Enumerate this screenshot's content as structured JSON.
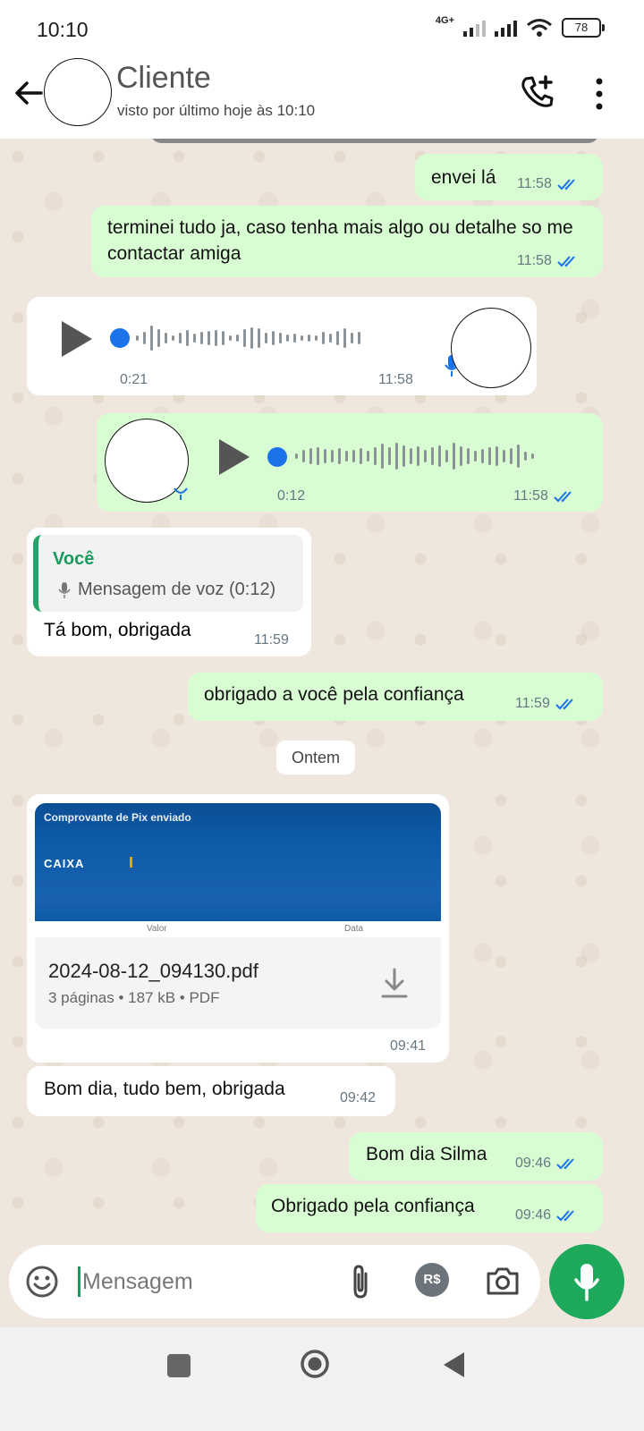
{
  "status_bar": {
    "time": "10:10",
    "network": "4G+",
    "battery": "78"
  },
  "header": {
    "name": "Cliente",
    "status": "visto por último hoje às 10:10"
  },
  "messages": {
    "m1": {
      "text": "envei lá",
      "time": "11:58"
    },
    "m2": {
      "text": "terminei tudo ja, caso tenha mais algo ou detalhe so me contactar amiga",
      "time": "11:58"
    },
    "voice_in": {
      "duration": "0:21",
      "time": "11:58"
    },
    "voice_out": {
      "duration": "0:12",
      "time": "11:58"
    },
    "reply": {
      "quoted_name": "Você",
      "quoted_text": "Mensagem de voz (0:12)",
      "text": "Tá bom, obrigada",
      "time": "11:59"
    },
    "m3": {
      "text": "obrigado a você pela confiança",
      "time": "11:59"
    },
    "date_chip": "Ontem",
    "pdf": {
      "preview_title": "Comprovante de Pix enviado",
      "preview_logo": "CAIXA",
      "preview_col_a": "Valor",
      "preview_col_b": "Data",
      "file_name": "2024-08-12_094130.pdf",
      "file_meta": "3 páginas • 187 kB • PDF",
      "time": "09:41"
    },
    "m4": {
      "text": "Bom dia, tudo bem, obrigada",
      "time": "09:42"
    },
    "m5": {
      "text": "Bom dia Silma",
      "time": "09:46"
    },
    "m6": {
      "text": "Obrigado pela confiança",
      "time": "09:46"
    }
  },
  "input": {
    "placeholder": "Mensagem",
    "pay_label": "R$"
  },
  "colors": {
    "outgoing": "#d9fdd3",
    "incoming": "#ffffff",
    "read_ticks": "#1a73e8",
    "accent": "#1ea95c"
  },
  "icons": [
    "back-arrow-icon",
    "add-call-icon",
    "more-vert-icon",
    "double-check-icon",
    "play-icon",
    "mic-icon",
    "download-icon",
    "emoji-icon",
    "paperclip-icon",
    "pix-payment-icon",
    "camera-icon",
    "nav-square-icon",
    "nav-home-icon",
    "nav-back-icon"
  ]
}
